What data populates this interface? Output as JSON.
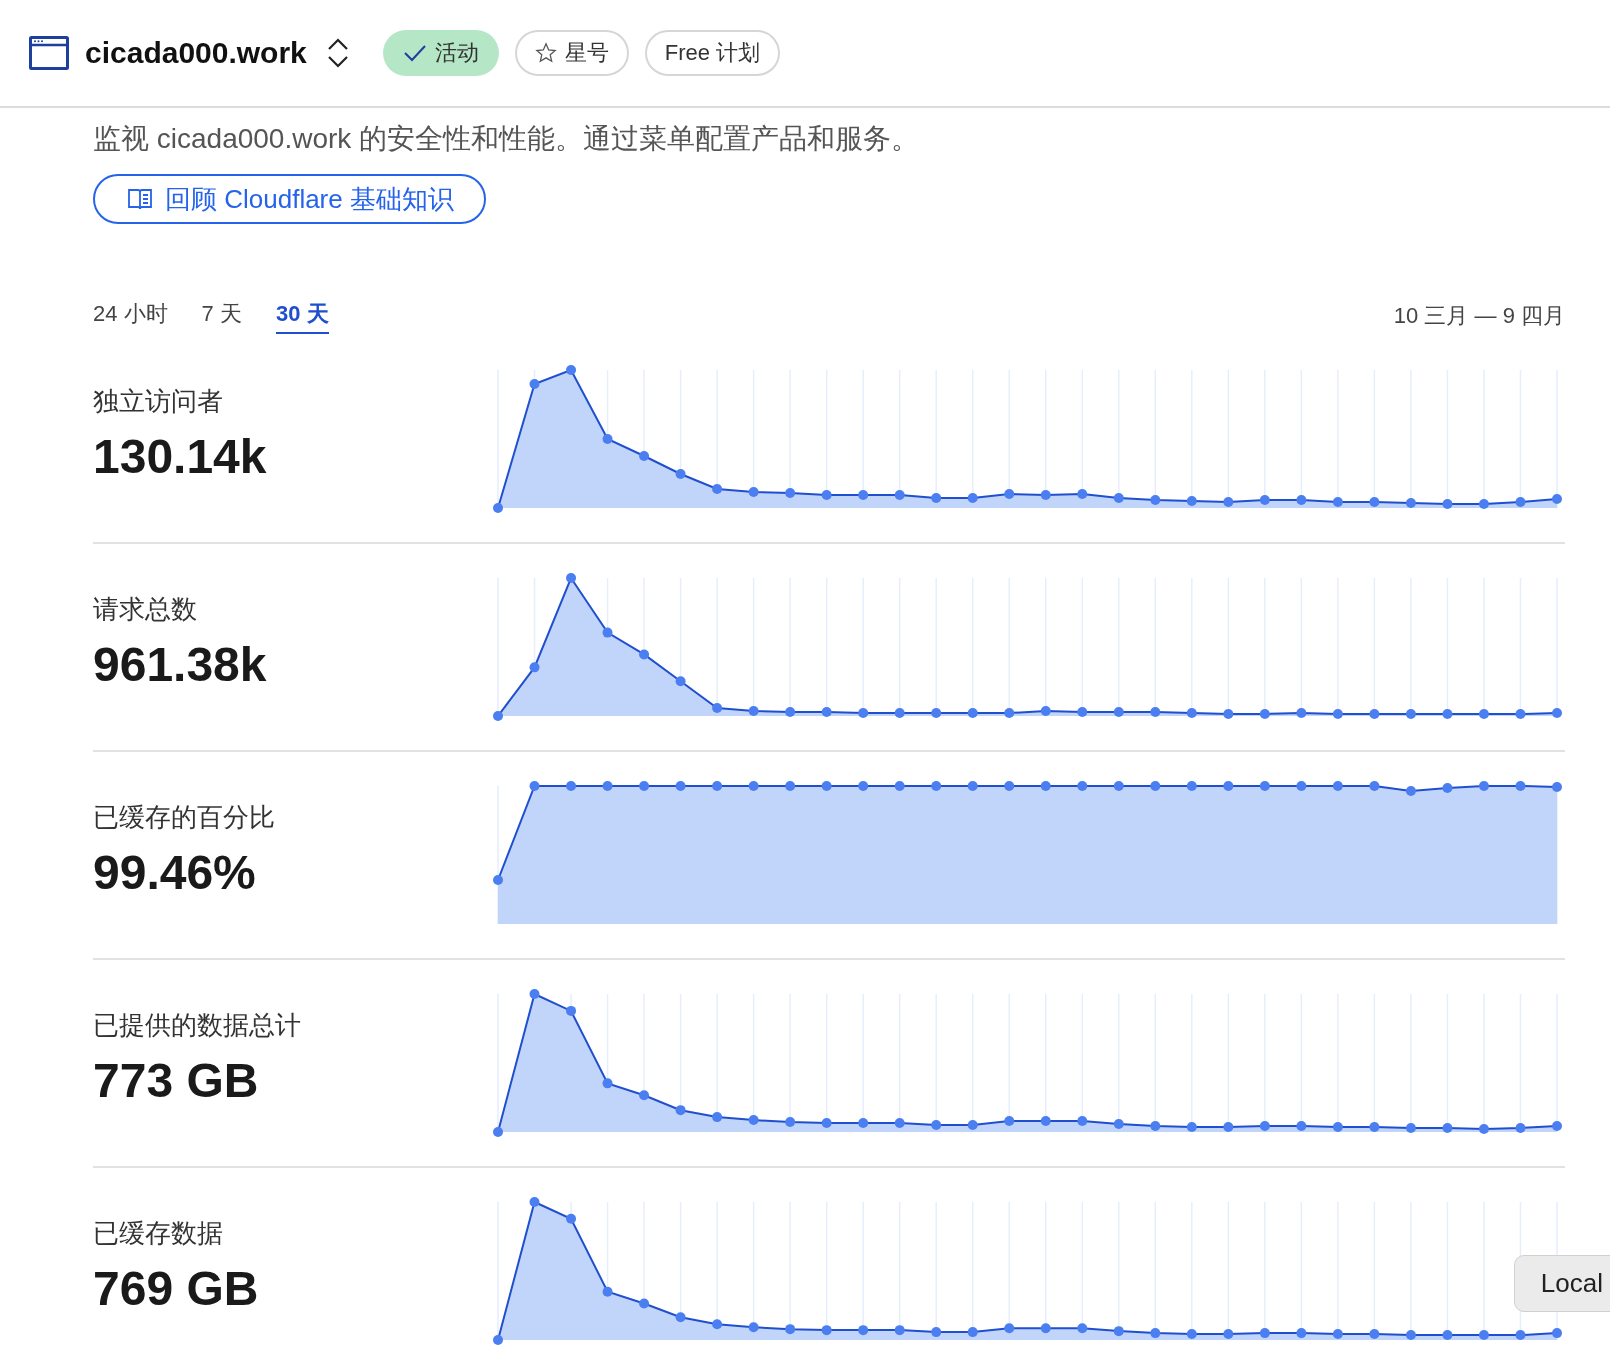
{
  "header": {
    "title": "cicada000.work",
    "badges": [
      {
        "kind": "status",
        "label": "活动"
      },
      {
        "kind": "star",
        "label": "星号"
      },
      {
        "kind": "plan",
        "label": "Free 计划"
      }
    ]
  },
  "description": "监视 cicada000.work 的安全性和性能。通过菜单配置产品和服务。",
  "link": {
    "label": "回顾 Cloudflare 基础知识"
  },
  "ranges": [
    {
      "label": "24 小时",
      "selected": false
    },
    {
      "label": "7 天",
      "selected": false
    },
    {
      "label": "30 天",
      "selected": true
    }
  ],
  "date_range": "10 三月 — 9 四月",
  "metrics": [
    {
      "label": "独立访问者",
      "value": "130.14k"
    },
    {
      "label": "请求总数",
      "value": "961.38k"
    },
    {
      "label": "已缓存的百分比",
      "value": "99.46%"
    },
    {
      "label": "已提供的数据总计",
      "value": "773 GB"
    },
    {
      "label": "已缓存数据",
      "value": "769 GB"
    }
  ],
  "tooltip": "Local"
}
